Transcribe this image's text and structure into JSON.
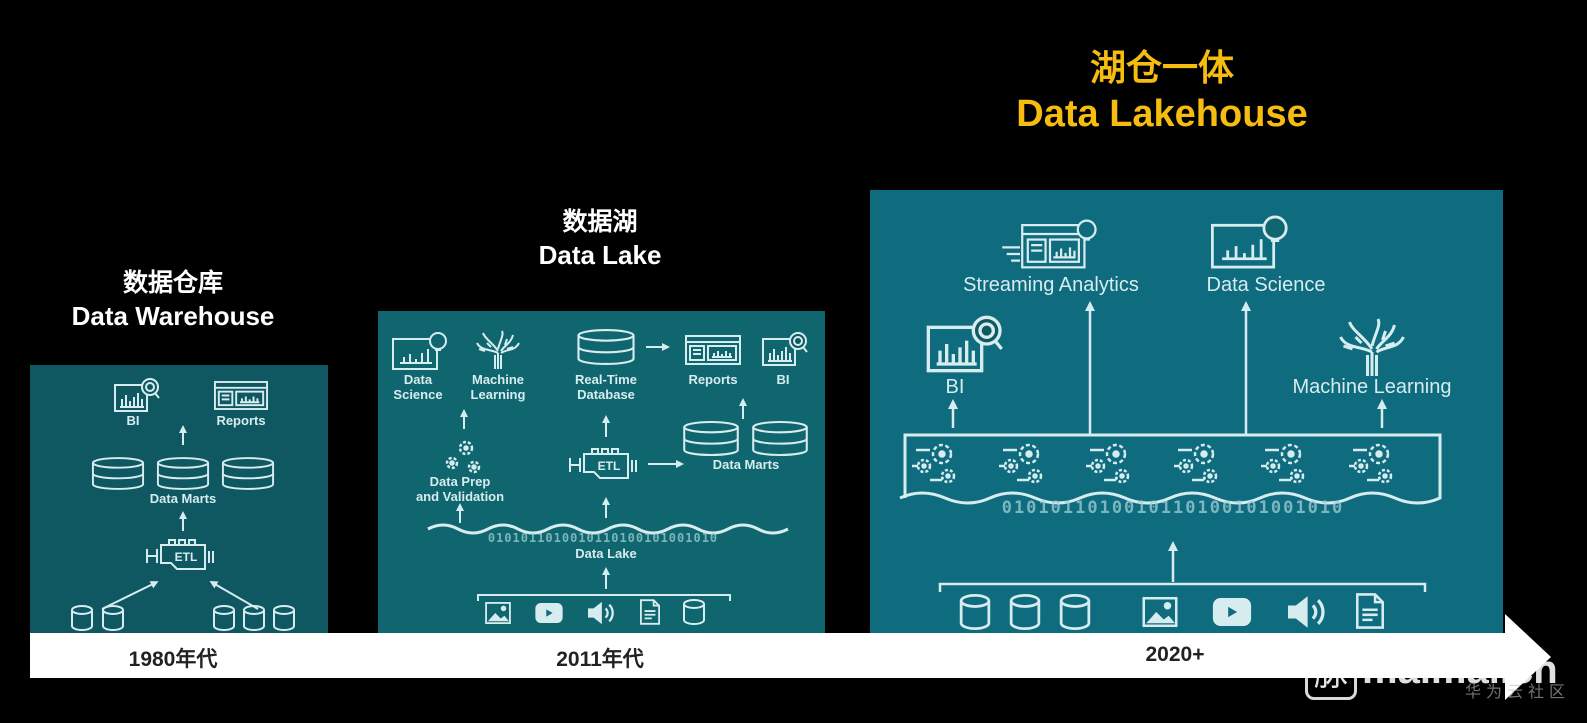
{
  "colors": {
    "background": "#000000",
    "panel_1": "#0f5862",
    "panel_2": "#10666f",
    "panel_3": "#0f6b7e",
    "icon_stroke": "#d6ecef",
    "highlight_title": "#f7bc10",
    "timeline": "#ffffff"
  },
  "stages": [
    {
      "title_cn": "数据仓库",
      "title_en": "Data Warehouse",
      "era": "1980年代",
      "labels": {
        "bi": "BI",
        "reports": "Reports",
        "data_marts": "Data Marts",
        "etl": "ETL"
      }
    },
    {
      "title_cn": "数据湖",
      "title_en": "Data Lake",
      "era": "2011年代",
      "labels": {
        "data_science_1": "Data",
        "data_science_2": "Science",
        "ml_1": "Machine",
        "ml_2": "Learning",
        "rtdb_1": "Real-Time",
        "rtdb_2": "Database",
        "reports": "Reports",
        "bi": "BI",
        "data_marts": "Data Marts",
        "etl": "ETL",
        "prep_1": "Data Prep",
        "prep_2": "and Validation",
        "data_lake": "Data Lake",
        "binary": "0101011010010110100101001010"
      }
    },
    {
      "title_cn": "湖仓一体",
      "title_en": "Data Lakehouse",
      "era": "2020+",
      "labels": {
        "streaming": "Streaming Analytics",
        "data_science": "Data Science",
        "bi": "BI",
        "ml": "Machine Learning",
        "binary": "0101011010010110100101001010"
      }
    }
  ],
  "icons": [
    "bi-chart-magnifier-icon",
    "reports-dashboard-icon",
    "database-stack-icon",
    "etl-engine-icon",
    "cylinder-database-icon",
    "lightbulb-chart-icon",
    "brain-tree-icon",
    "gears-icon",
    "image-icon",
    "video-play-icon",
    "speaker-icon",
    "document-icon",
    "streaming-dashboard-icon"
  ],
  "watermark": {
    "logo_char": "脉",
    "site": "maimai.cn",
    "sub": "华为云社区"
  }
}
